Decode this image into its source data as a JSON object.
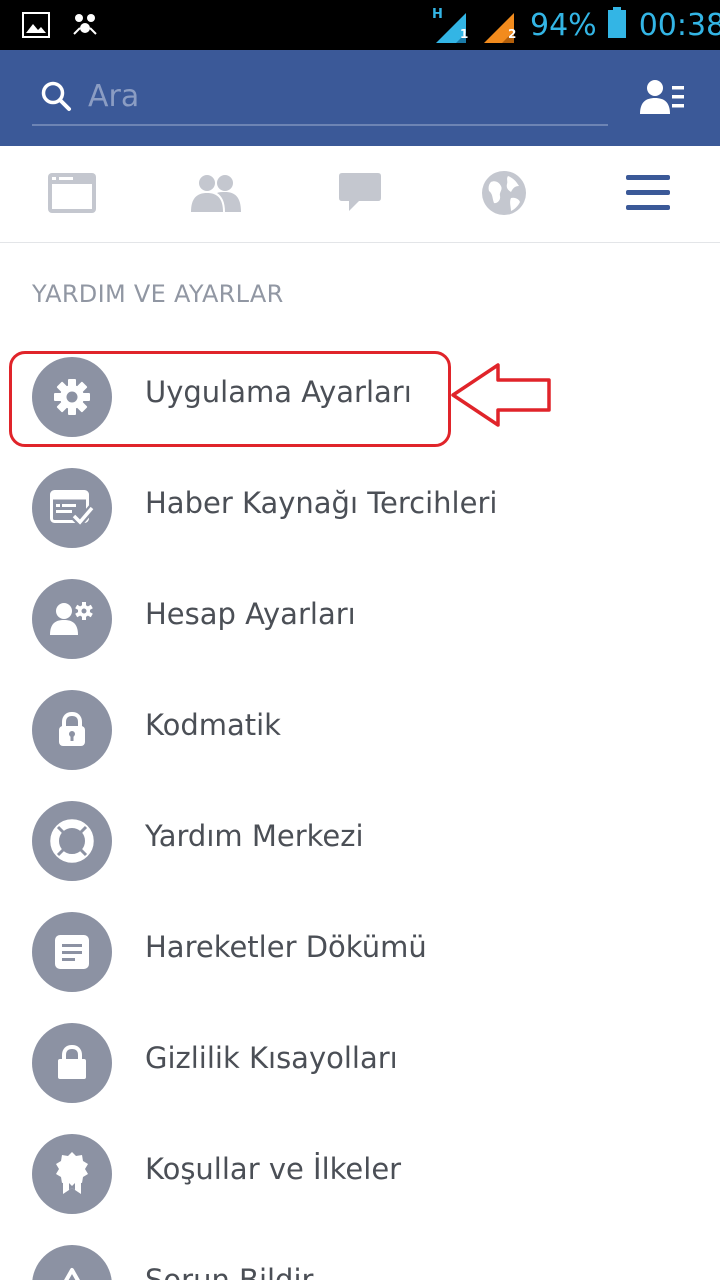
{
  "status_bar": {
    "battery_percent": "94%",
    "time": "00:38",
    "sim1_network": "H",
    "sim1_label": "1",
    "sim2_label": "2",
    "battery_level": 0.94
  },
  "search": {
    "placeholder": "Ara"
  },
  "tabs": [
    {
      "name": "news-feed",
      "icon": "news-feed-icon",
      "active": false
    },
    {
      "name": "friend-requests",
      "icon": "friends-icon",
      "active": false
    },
    {
      "name": "messages",
      "icon": "messages-icon",
      "active": false
    },
    {
      "name": "notifications",
      "icon": "globe-icon",
      "active": false
    },
    {
      "name": "more",
      "icon": "hamburger-menu-icon",
      "active": true
    }
  ],
  "section": {
    "title": "YARDIM VE AYARLAR"
  },
  "menu_items": [
    {
      "label": "Uygulama Ayarları",
      "icon": "gear-icon",
      "highlighted": true
    },
    {
      "label": "Haber Kaynağı Tercihleri",
      "icon": "news-feed-preferences-icon"
    },
    {
      "label": "Hesap Ayarları",
      "icon": "account-settings-icon"
    },
    {
      "label": "Kodmatik",
      "icon": "code-generator-lock-icon"
    },
    {
      "label": "Yardım Merkezi",
      "icon": "lifebuoy-icon"
    },
    {
      "label": "Hareketler Dökümü",
      "icon": "activity-log-icon"
    },
    {
      "label": "Gizlilik Kısayolları",
      "icon": "privacy-lock-icon"
    },
    {
      "label": "Koşullar ve İlkeler",
      "icon": "terms-badge-icon"
    },
    {
      "label": "Sorun Bildir",
      "icon": "report-problem-icon"
    }
  ],
  "colors": {
    "header_blue": "#3b5998",
    "active_tab": "#3b5998",
    "inactive_tab": "#c4c7cf",
    "menu_icon_bg": "#8c92a3",
    "annotation_red": "#e0242a",
    "status_text": "#33b5e5"
  }
}
